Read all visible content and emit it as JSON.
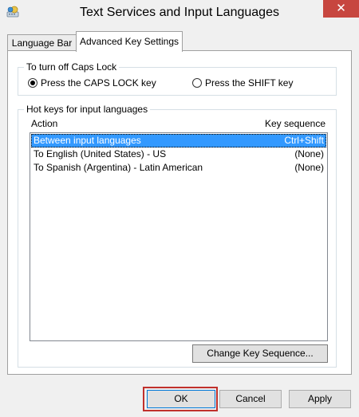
{
  "window": {
    "title": "Text Services and Input Languages",
    "close_symbol": "✕"
  },
  "tabs": [
    {
      "label": "Language Bar",
      "active": false
    },
    {
      "label": "Advanced Key Settings",
      "active": true
    }
  ],
  "caps_lock": {
    "group_label": "To turn off Caps Lock",
    "options": [
      {
        "label": "Press the CAPS LOCK key",
        "selected": true
      },
      {
        "label": "Press the SHIFT key",
        "selected": false
      }
    ]
  },
  "hot_keys": {
    "group_label": "Hot keys for input languages",
    "columns": {
      "action": "Action",
      "sequence": "Key sequence"
    },
    "rows": [
      {
        "action": "Between input languages",
        "sequence": "Ctrl+Shift",
        "selected": true
      },
      {
        "action": "To English (United States) - US",
        "sequence": "(None)",
        "selected": false
      },
      {
        "action": "To Spanish (Argentina) - Latin American",
        "sequence": "(None)",
        "selected": false
      }
    ],
    "change_button": "Change Key Sequence..."
  },
  "buttons": {
    "ok": "OK",
    "cancel": "Cancel",
    "apply": "Apply"
  },
  "icons": {
    "app": "keyboard-globe-icon",
    "close": "close-icon"
  },
  "colors": {
    "selection": "#3399ff",
    "close_button": "#c7463f",
    "ok_highlight": "#c0302c"
  }
}
